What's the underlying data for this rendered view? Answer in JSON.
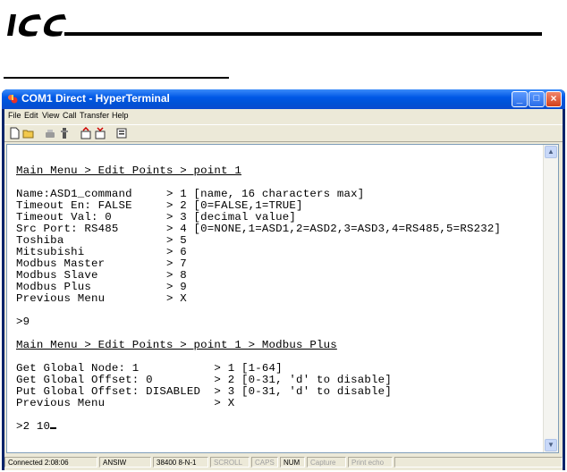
{
  "document": {
    "logo_text": "ICC"
  },
  "window": {
    "title": "COM1 Direct - HyperTerminal",
    "menu": [
      "File",
      "Edit",
      "View",
      "Call",
      "Transfer",
      "Help"
    ],
    "controls": {
      "minimize": "_",
      "maximize": "□",
      "close": "×"
    }
  },
  "toolbar": {
    "icons": [
      "new-icon",
      "open-icon",
      "connect-icon",
      "disconnect-icon",
      "send-icon",
      "receive-icon",
      "properties-icon"
    ]
  },
  "terminal": {
    "lines": [
      "",
      "Main Menu > Edit Points > point 1",
      "",
      "Name:ASD1_command     > 1 [name, 16 characters max]",
      "Timeout En: FALSE     > 2 [0=FALSE,1=TRUE]",
      "Timeout Val: 0        > 3 [decimal value]",
      "Src Port: RS485       > 4 [0=NONE,1=ASD1,2=ASD2,3=ASD3,4=RS485,5=RS232]",
      "Toshiba               > 5",
      "Mitsubishi            > 6",
      "Modbus Master         > 7",
      "Modbus Slave          > 8",
      "Modbus Plus           > 9",
      "Previous Menu         > X",
      "",
      ">9",
      "",
      "Main Menu > Edit Points > point 1 > Modbus Plus",
      "",
      "Get Global Node: 1           > 1 [1-64]",
      "Get Global Offset: 0         > 2 [0-31, 'd' to disable]",
      "Put Global Offset: DISABLED  > 3 [0-31, 'd' to disable]",
      "Previous Menu                > X",
      "",
      ">2 10"
    ]
  },
  "statusbar": {
    "connected": "Connected 2:08:06",
    "emulation": "ANSIW",
    "settings": "38400 8-N-1",
    "scroll": "SCROLL",
    "caps": "CAPS",
    "num": "NUM",
    "capture": "Capture",
    "print_echo": "Print echo"
  }
}
